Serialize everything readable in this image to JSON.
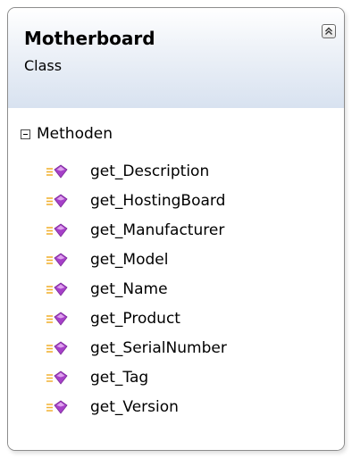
{
  "class": {
    "name": "Motherboard",
    "kind": "Class",
    "collapse_icon": "double-chevron-up-icon"
  },
  "methods_section": {
    "label": "Methoden",
    "toggle_icon": "collapse-minus-icon",
    "member_icon": "public-method-icon",
    "items": [
      {
        "label": "get_Description"
      },
      {
        "label": "get_HostingBoard"
      },
      {
        "label": "get_Manufacturer"
      },
      {
        "label": "get_Model"
      },
      {
        "label": "get_Name"
      },
      {
        "label": "get_Product"
      },
      {
        "label": "get_SerialNumber"
      },
      {
        "label": "get_Tag"
      },
      {
        "label": "get_Version"
      }
    ]
  },
  "colors": {
    "border": "#8c8c8c",
    "header_gradient_top": "#ffffff",
    "header_gradient_bottom": "#d8e2f0",
    "method_icon_purple": "#a640c8",
    "method_icon_lines": "#f2b233"
  }
}
